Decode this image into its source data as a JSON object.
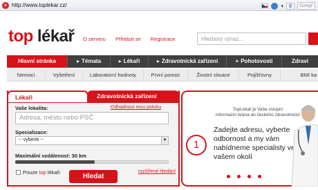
{
  "browser": {
    "url": "http://www.toplekar.cz/",
    "search_engine": "Google",
    "search_placeholder": "Googl"
  },
  "header": {
    "logo_top": "top",
    "logo_lekar": "lékař",
    "links": [
      "O serveru",
      "Přihlásit se",
      "Registrace"
    ],
    "search_placeholder": "Hledaný výraz..."
  },
  "main_nav": [
    {
      "label": "Hlavní stránka",
      "symbol": "",
      "active": true
    },
    {
      "label": "Témata",
      "symbol": "▸",
      "active": false
    },
    {
      "label": "Lékaři",
      "symbol": "▸",
      "active": false
    },
    {
      "label": "Zdravotnická zařízení",
      "symbol": "▸",
      "active": false
    },
    {
      "label": "Pohotovosti",
      "symbol": "+",
      "active": false
    },
    {
      "label": "Zdraví",
      "symbol": "",
      "active": false
    }
  ],
  "sub_nav": [
    "Nemoci",
    "Vyšetření",
    "Laboratorní hodnoty",
    "První pomoc",
    "Životní situace",
    "Pojišťovny",
    "BMI ka"
  ],
  "search_panel": {
    "tab_active": "Lékaři",
    "tab_other": "Zdravotnická zařízení",
    "location_label": "Vaše lokalita:",
    "detect_link": "Odhadnout mou polohu",
    "location_placeholder": "Adresa, město nebo PSČ",
    "specialization_label": "Specializace:",
    "specialization_value": "-- vyberte --",
    "distance_label": "Maximální vzdálenost: 30 km",
    "distance_fraction": 0.52,
    "checkbox_label_pre": "Pouze",
    "checkbox_label_red": "top",
    "checkbox_label_post": "lékaři",
    "search_button": "Hledat",
    "advanced_link": "rozšířené hledání"
  },
  "promo": {
    "intro_line1": "TopLékař je Vaše vstupní",
    "intro_line2": "informační brána do českého zdravotnictví",
    "step_number": "1",
    "text": "Zadejte adresu, vyberte odbornost a my vám nabídneme specialisty ve vašem okolí",
    "dot_count": 4
  },
  "colors": {
    "brand_red": "#d6131a",
    "nav_dark": "#3f3f3f"
  }
}
